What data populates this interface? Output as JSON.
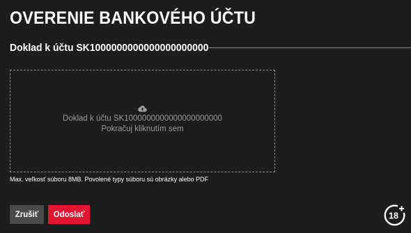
{
  "header": {
    "title": "OVERENIE BANKOVÉHO ÚČTU",
    "subtitle": "Doklad k účtu SK1000000000000000000000"
  },
  "upload": {
    "icon": "cloud-upload-icon",
    "label": "Doklad k účtu SK1000000000000000000000",
    "action": "Pokračuj kliknutím sem",
    "hint": "Max. veľkosť súboru 8MB. Povolené typy súboru sú obrázky alebo PDF"
  },
  "actions": {
    "cancel_label": "Zrušiť",
    "submit_label": "Odoslať"
  },
  "badge": {
    "icon": "age-18-plus-icon",
    "label": "18+"
  },
  "colors": {
    "background": "#1d1d1d",
    "accent": "#e3162f",
    "cancel": "#4a4a4a",
    "muted_text": "#9a9a9a"
  }
}
